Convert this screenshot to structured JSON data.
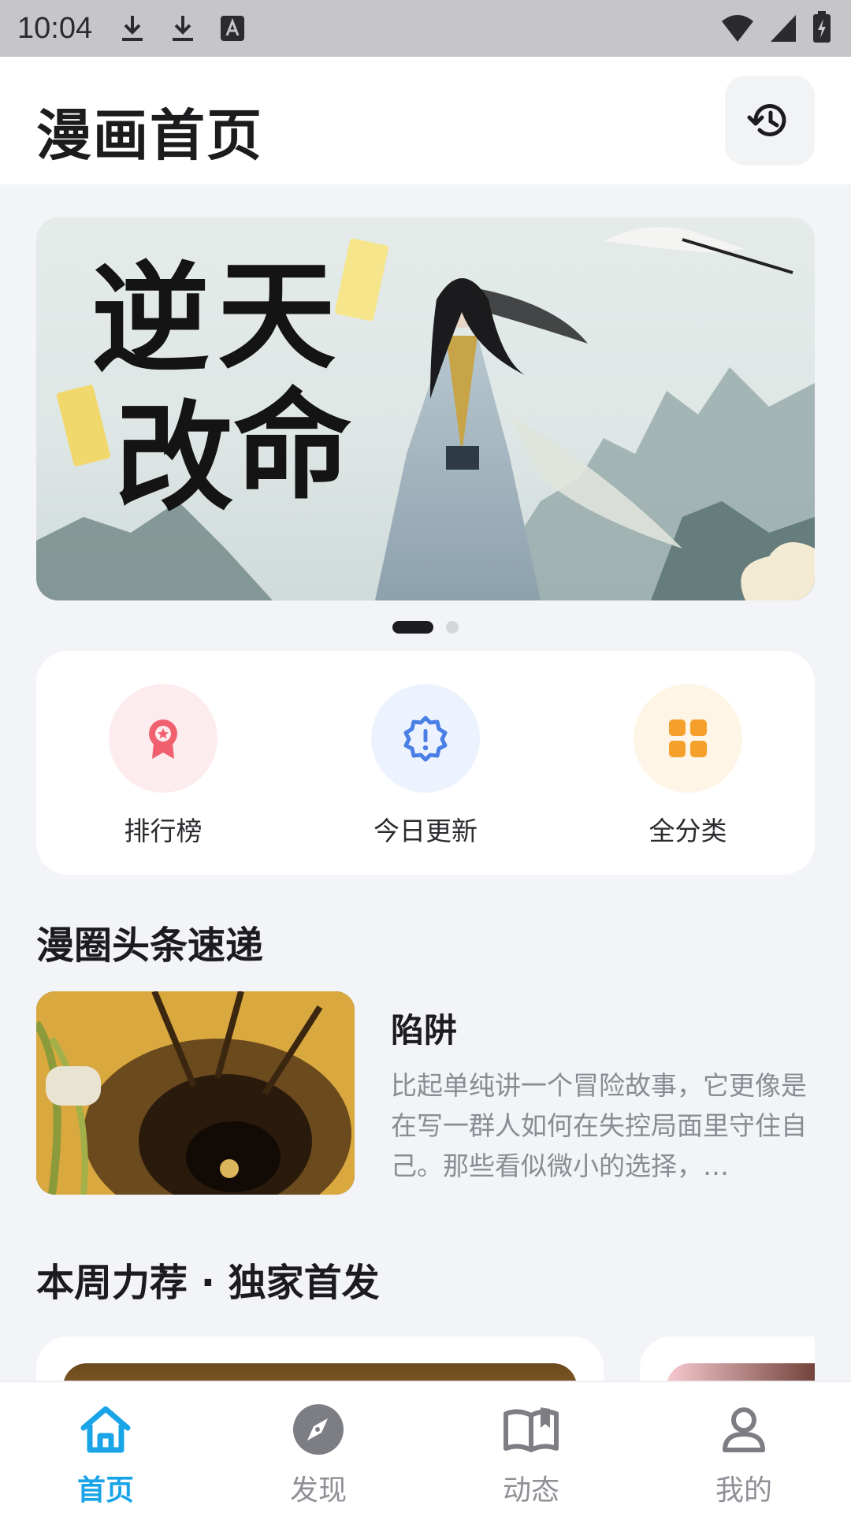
{
  "status_bar": {
    "time": "10:04"
  },
  "header": {
    "title": "漫画首页"
  },
  "banner": {
    "calligraphy": [
      "逆",
      "天",
      "改",
      "命"
    ],
    "dots_total": 2,
    "active_dot": 1
  },
  "quick_actions": [
    {
      "label": "排行榜",
      "icon": "medal-icon",
      "bg": "#fdecee",
      "color": "#f0606e"
    },
    {
      "label": "今日更新",
      "icon": "badge-alert-icon",
      "bg": "#edf3fe",
      "color": "#4a7fe6"
    },
    {
      "label": "全分类",
      "icon": "grid-icon",
      "bg": "#fff5e6",
      "color": "#f5a02a"
    }
  ],
  "news_section": {
    "title": "漫圈头条速递",
    "item": {
      "title": "陷阱",
      "excerpt": "比起单纯讲一个冒险故事，它更像是在写一群人如何在失控局面里守住自己。那些看似微小的选择，…"
    }
  },
  "recommend_section": {
    "title": "本周力荐 · 独家首发"
  },
  "bottom_nav": [
    {
      "label": "首页",
      "icon": "home-icon",
      "active": true
    },
    {
      "label": "发现",
      "icon": "compass-icon",
      "active": false
    },
    {
      "label": "动态",
      "icon": "book-icon",
      "active": false
    },
    {
      "label": "我的",
      "icon": "user-icon",
      "active": false
    }
  ],
  "colors": {
    "accent": "#1aa4e8",
    "text": "#1c1c1f",
    "muted": "#8a8c93",
    "page_bg": "#f3f4f7"
  }
}
